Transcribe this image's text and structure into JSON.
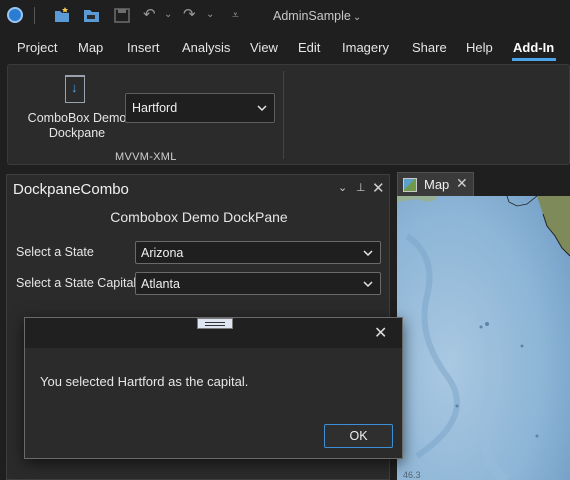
{
  "titlebar": {
    "project_title": "AdminSample",
    "project_title_chevron": "chevron-down-icon",
    "icons": [
      "arcgis-pro-logo-icon",
      "new-project-icon",
      "open-project-icon",
      "save-project-icon",
      "undo-icon",
      "redo-icon",
      "customize-qat-icon"
    ]
  },
  "menu": {
    "tabs": [
      {
        "label": "Project"
      },
      {
        "label": "Map"
      },
      {
        "label": "Insert"
      },
      {
        "label": "Analysis"
      },
      {
        "label": "View"
      },
      {
        "label": "Edit"
      },
      {
        "label": "Imagery"
      },
      {
        "label": "Share"
      },
      {
        "label": "Help"
      },
      {
        "label": "Add-In",
        "active": true
      }
    ]
  },
  "ribbon": {
    "button_label": "ComboBox Demo Dockpane",
    "combo_value": "Hartford",
    "group_label": "MVVM-XML"
  },
  "dockpane": {
    "title": "DockpaneCombo",
    "heading": "Combobox Demo DockPane",
    "state_label": "Select a State",
    "state_value": "Arizona",
    "capital_label": "Select a State Capital",
    "capital_value": "Atlanta"
  },
  "map": {
    "tab_label": "Map",
    "scale_fragment": "46.3"
  },
  "dialog": {
    "message": "You selected Hartford as the capital.",
    "ok_label": "OK"
  },
  "colors": {
    "accent": "#4ba3e8",
    "background": "#1f1f1f",
    "panel": "#2b2b2b"
  }
}
